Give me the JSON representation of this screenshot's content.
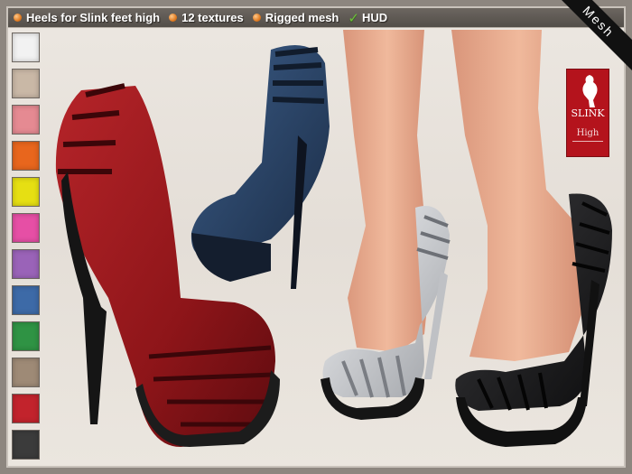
{
  "header": {
    "features": [
      {
        "text": "Heels for Slink feet high",
        "bullet": "orange-dot"
      },
      {
        "text": "12 textures",
        "bullet": "orange-dot"
      },
      {
        "text": "Rigged mesh",
        "bullet": "orange-dot"
      },
      {
        "text": "HUD",
        "bullet": "check"
      }
    ]
  },
  "corner_banner": "Mesh",
  "swatches": [
    {
      "color": "#f2f2f2"
    },
    {
      "color": "#c9b8a6"
    },
    {
      "color": "#e58a92"
    },
    {
      "color": "#e8661d"
    },
    {
      "color": "#e6df13"
    },
    {
      "color": "#e64fa5"
    },
    {
      "color": "#9a63b8"
    },
    {
      "color": "#3d6aa7"
    },
    {
      "color": "#2f9344"
    },
    {
      "color": "#9e8a76"
    },
    {
      "color": "#c2232c"
    },
    {
      "color": "#3b3b3b"
    }
  ],
  "logo": {
    "brand": "SLINK",
    "sub": "High"
  },
  "colors": {
    "red_shoe": "#9b1a1e",
    "blue_shoe": "#2a4466",
    "white_shoe": "#d9dadd",
    "black_shoe": "#1d1d1f",
    "skin": "#e5a88a"
  }
}
